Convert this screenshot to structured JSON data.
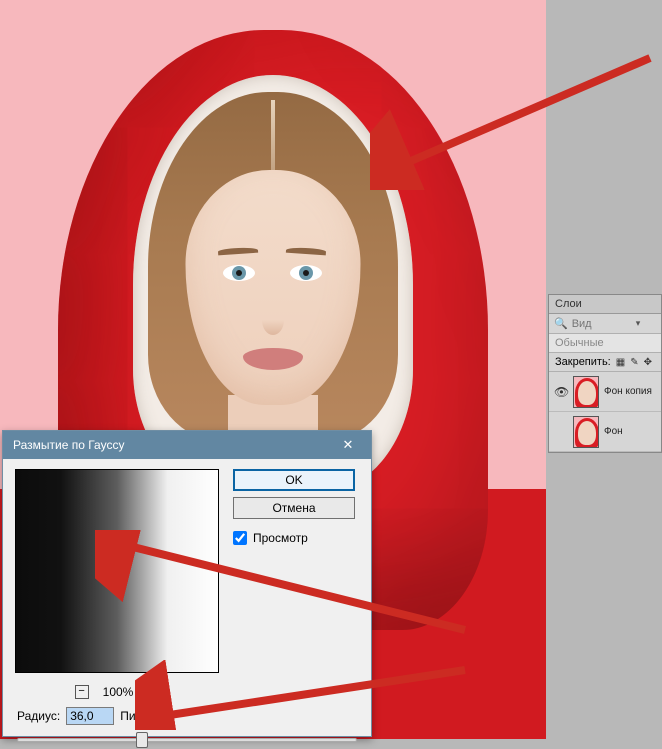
{
  "dialog": {
    "title": "Размытие по Гауссу",
    "ok": "OK",
    "cancel": "Отмена",
    "preview_label": "Просмотр",
    "preview_checked": true,
    "zoom_percent": "100%",
    "radius_label": "Радиус:",
    "radius_value": "36,0",
    "radius_unit": "Пикселы",
    "slider_position_percent": 35
  },
  "layers_panel": {
    "title": "Слои",
    "filter_placeholder": "Вид",
    "blend_mode": "Обычные",
    "lock_label": "Закрепить:",
    "layers": [
      {
        "name": "Фон копия",
        "visible": true
      },
      {
        "name": "Фон",
        "visible": false
      }
    ]
  }
}
